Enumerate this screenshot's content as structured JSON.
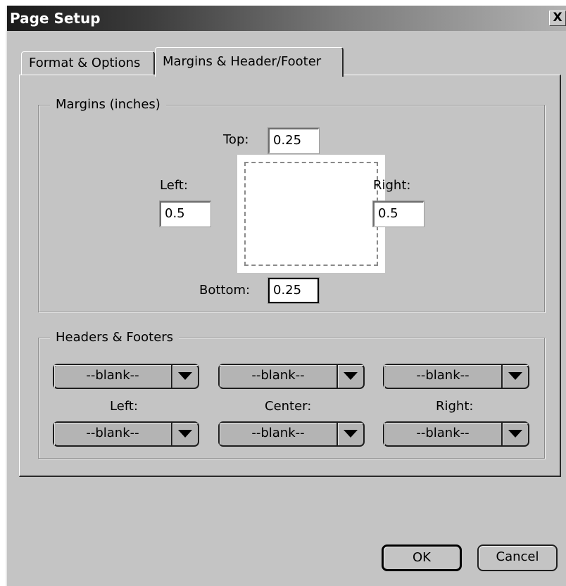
{
  "window": {
    "title": "Page Setup",
    "close_label": "X"
  },
  "tabs": [
    {
      "label": "Format & Options",
      "active": false
    },
    {
      "label": "Margins & Header/Footer",
      "active": true
    }
  ],
  "margins": {
    "legend": "Margins (inches)",
    "top_label": "Top:",
    "top_value": "0.25",
    "left_label": "Left:",
    "left_value": "0.5",
    "right_label": "Right:",
    "right_value": "0.5",
    "bottom_label": "Bottom:",
    "bottom_value": "0.25"
  },
  "headers_footers": {
    "legend": "Headers & Footers",
    "header_left": "--blank--",
    "header_center": "--blank--",
    "header_right": "--blank--",
    "left_label": "Left:",
    "center_label": "Center:",
    "right_label": "Right:",
    "footer_left": "--blank--",
    "footer_center": "--blank--",
    "footer_right": "--blank--"
  },
  "buttons": {
    "ok": "OK",
    "cancel": "Cancel"
  }
}
